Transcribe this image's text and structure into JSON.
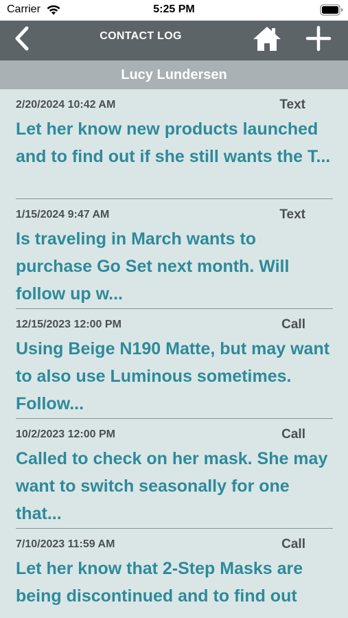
{
  "status_bar": {
    "carrier": "Carrier",
    "time": "5:25 PM"
  },
  "nav": {
    "title": "CONTACT LOG",
    "back_icon": "chevron-left-icon",
    "home_icon": "home-icon",
    "add_icon": "plus-icon"
  },
  "contact": {
    "name": "Lucy Lundersen"
  },
  "colors": {
    "nav_background": "#5d6468",
    "header_background": "#a9b1b4",
    "list_background": "#dae6e6",
    "note_text": "#2e8a9a",
    "meta_text": "#4a4f52"
  },
  "log_entries": [
    {
      "date": "2/20/2024 10:42 AM",
      "type": "Text",
      "note": "Let her know new products launched and to find out if she still wants the T..."
    },
    {
      "date": "1/15/2024 9:47 AM",
      "type": "Text",
      "note": "Is traveling in March wants to purchase Go Set next month. Will follow up w..."
    },
    {
      "date": "12/15/2023 12:00 PM",
      "type": "Call",
      "note": "Using Beige N190 Matte, but may want to also use Luminous sometimes. Follow..."
    },
    {
      "date": "10/2/2023 12:00 PM",
      "type": "Call",
      "note": "Called to check on her mask. She may want to switch seasonally for one that..."
    },
    {
      "date": "7/10/2023 11:59 AM",
      "type": "Call",
      "note": "Let her know that 2-Step Masks are being discontinued and to find out"
    }
  ]
}
